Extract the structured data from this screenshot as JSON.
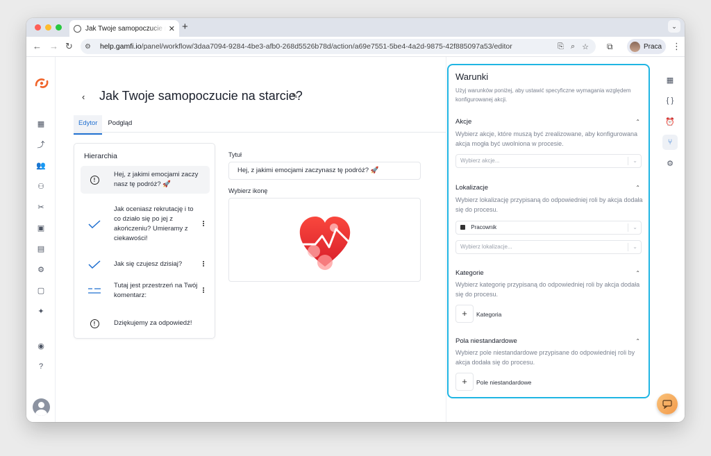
{
  "browser": {
    "tab_title": "Jak Twoje samopoczucie na starcie?",
    "tab_close": "✕",
    "new_tab": "+",
    "url_host": "help.gamfi.io",
    "url_path": "/panel/workflow/3daa7094-9284-4be3-afb0-268d5526b78d/action/a69e7551-5be4-4a2d-9875-42f885097a53/editor",
    "profile_name": "Praca"
  },
  "page": {
    "title": "Jak Twoje samopoczucie na starcie?",
    "tabs": [
      {
        "label": "Edytor",
        "active": true
      },
      {
        "label": "Podgląd",
        "active": false
      }
    ]
  },
  "hierarchy": {
    "heading": "Hierarchia",
    "items": [
      {
        "icon": "alert-circle-icon",
        "text": "Hej, z jakimi emocjami zaczy nasz tę podróż? 🚀",
        "selected": true,
        "menu": false
      },
      {
        "icon": "check-icon",
        "text": "Jak oceniasz rekrutację i to co działo się po jej z akończeniu? Umieramy z ciekawości!",
        "selected": false,
        "menu": true
      },
      {
        "icon": "check-icon",
        "text": "Jak się czujesz dzisiaj?",
        "selected": false,
        "menu": true
      },
      {
        "icon": "text-lines-icon",
        "text": "Tutaj jest przestrzeń na Twój komentarz:",
        "selected": false,
        "menu": true
      },
      {
        "icon": "alert-circle-icon",
        "text": "Dziękujemy za odpowiedź!",
        "selected": false,
        "menu": false
      }
    ]
  },
  "form": {
    "title_label": "Tytuł",
    "title_value": "Hej, z jakimi emocjami zaczynasz tę podróż? 🚀",
    "icon_label": "Wybierz ikonę",
    "icon_name": "heart-pulse-icon"
  },
  "conditions": {
    "heading": "Warunki",
    "description": "Użyj warunków poniżej, aby ustawić specyficzne wymagania względem konfigurowanej akcji.",
    "actions": {
      "heading": "Akcje",
      "description": "Wybierz akcje, które muszą być zrealizowane, aby konfigurowana akcja mogła być uwolniona w procesie.",
      "placeholder": "Wybierz akcje..."
    },
    "locations": {
      "heading": "Lokalizacje",
      "description": "Wybierz lokalizację przypisaną do odpowiedniej roli by akcja dodała się do procesu.",
      "selected_value": "Pracownik",
      "placeholder": "Wybierz lokalizacje..."
    },
    "categories": {
      "heading": "Kategorie",
      "description": "Wybierz kategorię przypisaną do odpowiedniej roli by akcja dodała się do procesu.",
      "add_label": "Kategoria"
    },
    "custom_fields": {
      "heading": "Pola niestandardowe",
      "description": "Wybierz pole niestandardowe przypisane do odpowiedniej roli by akcja dodała się do procesu.",
      "add_label": "Pole niestandardowe"
    }
  },
  "colors": {
    "accent": "#1f6fd0",
    "panel_border": "#1fb5e3",
    "brand": "#f0642a"
  }
}
